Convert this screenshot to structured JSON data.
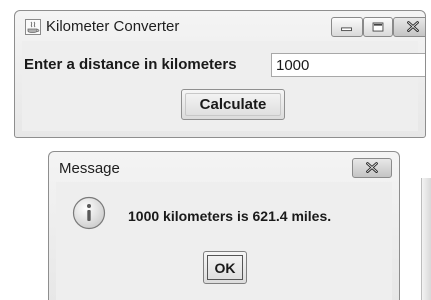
{
  "main_window": {
    "title": "Kilometer Converter",
    "icon": "java-app-icon",
    "controls": [
      "minimize-icon",
      "maximize-icon",
      "close-icon"
    ],
    "prompt_label": "Enter a distance in kilometers",
    "distance_input_value": "1000",
    "calculate_label": "Calculate"
  },
  "message_dialog": {
    "title": "Message",
    "icon": "info-icon",
    "message": "1000 kilometers is 621.4 miles.",
    "ok_label": "OK"
  }
}
